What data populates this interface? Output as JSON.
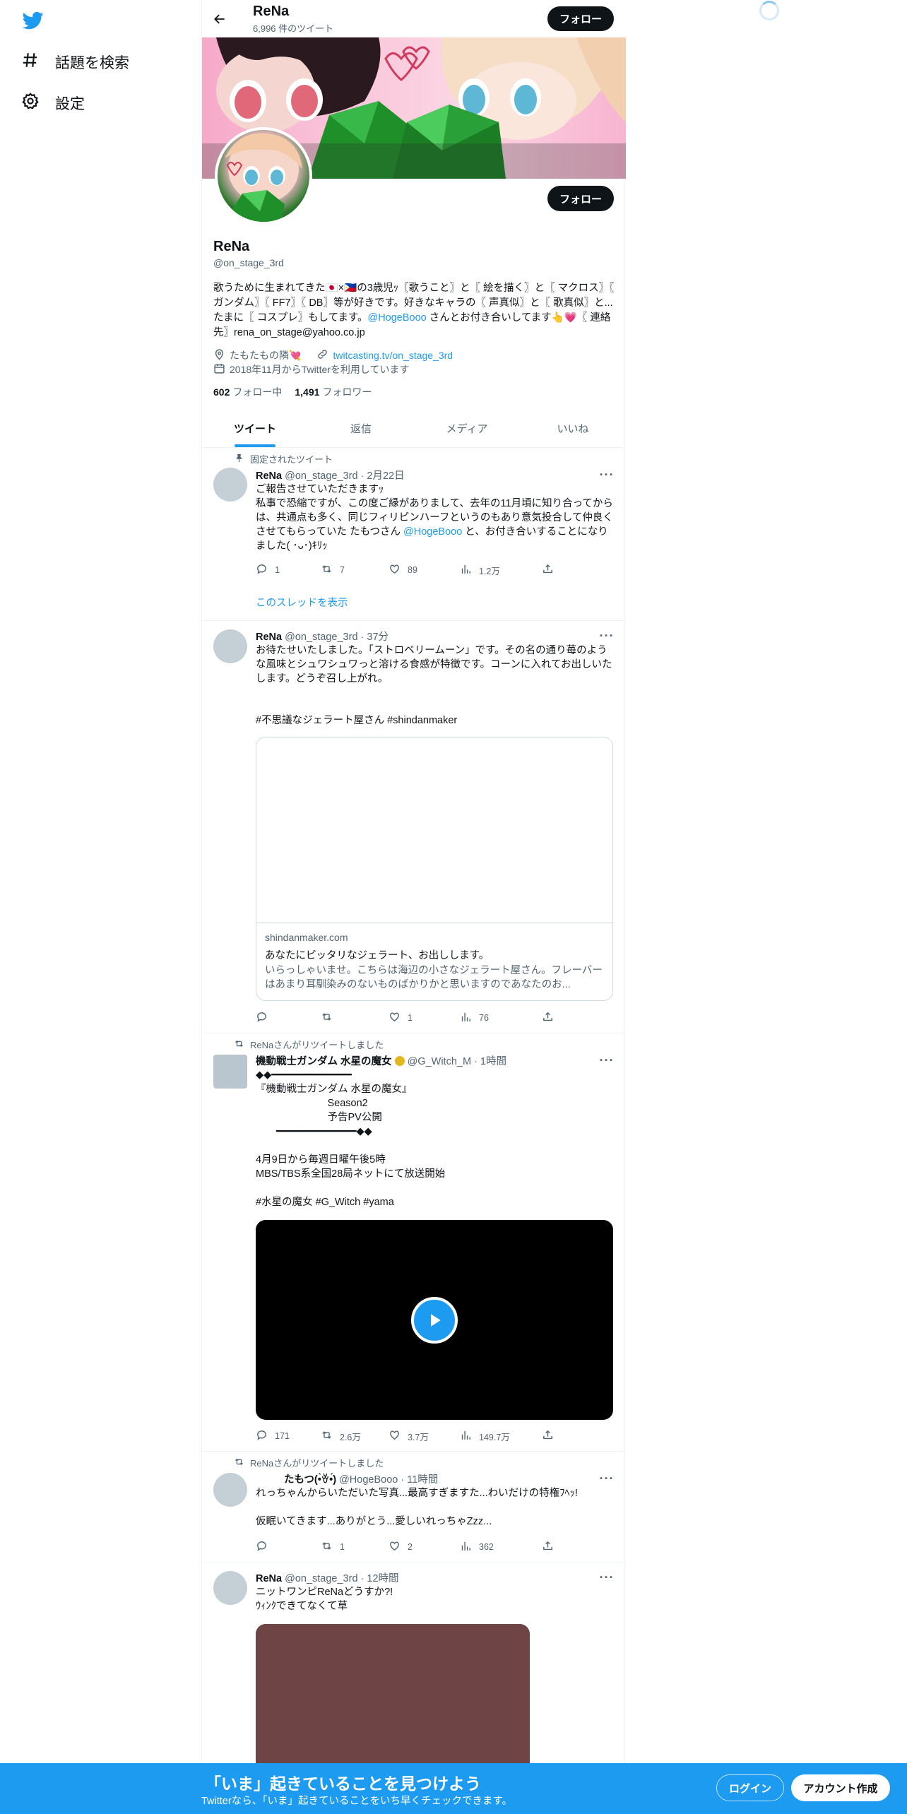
{
  "nav": {
    "items": [
      {
        "label": "話題を検索",
        "icon": "hashtag-icon"
      },
      {
        "label": "設定",
        "icon": "gear-icon"
      }
    ]
  },
  "header": {
    "name": "ReNa",
    "tweet_count": "6,996 件のツイート",
    "follow_label": "フォロー"
  },
  "profile": {
    "name": "ReNa",
    "handle": "@on_stage_3rd",
    "follow_label": "フォロー",
    "bio_1": "歌うために生まれてきた🇯🇵×🇵🇭の3歳児ｯ〖歌うこと〗と〖 絵を描く〗と〖 マクロス〗〖 ガンダム〗〖 FF7〗〖 DB〗等が好きです。好きなキャラの〖 声真似〗と〖 歌真似〗と...たまに〖 コスプレ〗もしてます。",
    "bio_mention": "@HogeBooo",
    "bio_2": " さんとお付き合いしてます👆💗〖 連絡先〗rena_on_stage@yahoo.co.jp",
    "location": "たもたもの隣💘",
    "website": "twitcasting.tv/on_stage_3rd",
    "joined": "2018年11月からTwitterを利用しています",
    "following_count": "602",
    "following_label": "フォロー中",
    "followers_count": "1,491",
    "followers_label": "フォロワー"
  },
  "tabs": [
    {
      "label": "ツイート",
      "active": true
    },
    {
      "label": "返信"
    },
    {
      "label": "メディア"
    },
    {
      "label": "いいね"
    }
  ],
  "tweets": [
    {
      "context": "固定されたツイート",
      "name": "ReNa",
      "meta": " @on_stage_3rd · 2月22日",
      "text_1": "ご報告させていただきますｯ\n私事で恐縮ですが、この度ご縁がありまして、去年の11月頃に知り合ってからは、共通点も多く、同じフィリピンハーフというのもあり意気投合して仲良くさせてもらっていた たもつさん ",
      "mention": "@HogeBooo",
      "text_2": " と、お付き合いすることになりました( ･ᴗ･)ｷﾘｯ",
      "replies": "1",
      "retweets": "7",
      "likes": "89",
      "views": "1.2万",
      "thread_link": "このスレッドを表示"
    },
    {
      "name": "ReNa",
      "meta": " @on_stage_3rd · 37分",
      "text": "お待たせいたしました。「ストロベリームーン」です。その名の通り苺のような風味とシュワシュワっと溶ける食感が特徴です。コーンに入れてお出しいたします。どうぞ召し上がれ。",
      "hashtags": "#不思議なジェラート屋さん #shindanmaker",
      "card_domain": "shindanmaker.com",
      "card_title": "あなたにピッタリなジェラート、お出しします。",
      "card_desc": "いらっしゃいませ。こちらは海辺の小さなジェラート屋さん。フレーバーはあまり耳馴染みのないものばかりかと思いますのであなたのお...",
      "replies": "",
      "retweets": "",
      "likes": "1",
      "views": "76"
    },
    {
      "context": "ReNaさんがリツイートしました",
      "name": "機動戦士ガンダム 水星の魔女",
      "meta": " @G_Witch_M · 1時間",
      "text": "◆◆━━━━━━━━━━━━━\n『機動戦士ガンダム 水星の魔女』\n　　　　　　　Season2\n　　　　　　　予告PV公開\n　　━━━━━━━━━━━━━◆◆\n\n4月9日から毎週日曜午後5時\nMBS/TBS系全国28局ネットにて放送開始",
      "hashtags": "#水星の魔女 #G_Witch #yama",
      "replies": "171",
      "retweets": "2.6万",
      "likes": "3.7万",
      "views": "149.7万"
    },
    {
      "context": "ReNaさんがリツイートしました",
      "name": "たもつ(•̀ꈊ•́)",
      "meta": " @HogeBooo · 11時間",
      "text": "れっちゃんからいただいた写真...最高すぎますた...わいだけの特権ﾌﾍｯ!\n\n仮眠いてきます...ありがとう...愛しいれっちゃZzz...",
      "replies": "",
      "retweets": "1",
      "likes": "2",
      "views": "362"
    },
    {
      "name": "ReNa",
      "meta": " @on_stage_3rd · 12時間",
      "text": "ニットワンピReNaどうすか?!\nｳｨﾝｸできてなくて草"
    }
  ],
  "bottom": {
    "title": "「いま」起きていることを見つけよう",
    "subtitle": "Twitterなら、「いま」起きていることをいち早くチェックできます。",
    "login": "ログイン",
    "signup": "アカウント作成"
  },
  "colors": {
    "accent": "#1d9bf0",
    "text": "#0f1419",
    "muted": "#536471"
  }
}
